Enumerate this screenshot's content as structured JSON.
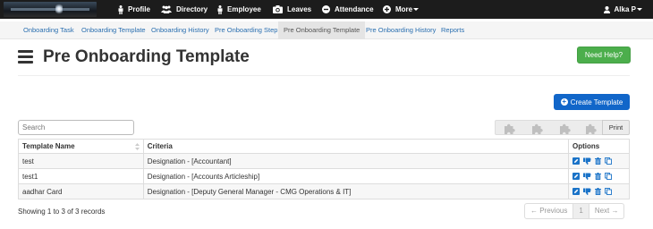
{
  "nav": {
    "items": [
      {
        "label": "Profile",
        "icon": "profile-icon"
      },
      {
        "label": "Directory",
        "icon": "directory-icon"
      },
      {
        "label": "Employee",
        "icon": "employee-icon"
      },
      {
        "label": "Leaves",
        "icon": "camera-icon"
      },
      {
        "label": "Attendance",
        "icon": "attendance-icon"
      },
      {
        "label": "More",
        "icon": "plus-circle-icon"
      }
    ],
    "user": "Alka P"
  },
  "subnav": {
    "items": [
      {
        "label": "Onboarding Task"
      },
      {
        "label": "Onboarding Template"
      },
      {
        "label": "Onboarding History"
      },
      {
        "label": "Pre Onboarding Step"
      },
      {
        "label": "Pre Onboarding Template",
        "active": true
      },
      {
        "label": "Pre Onboarding History"
      },
      {
        "label": "Reports"
      }
    ]
  },
  "page": {
    "title": "Pre Onboarding Template",
    "help_label": "Need Help?",
    "create_label": "Create Template",
    "search_placeholder": "Search",
    "print_label": "Print"
  },
  "table": {
    "columns": [
      "Template Name",
      "Criteria",
      "Options"
    ],
    "rows": [
      {
        "name": "test",
        "criteria": "Designation - [Accountant]"
      },
      {
        "name": "test1",
        "criteria": "Designation - [Accounts Articleship]"
      },
      {
        "name": "aadhar Card",
        "criteria": "Designation - [Deputy General Manager - CMG Operations & IT]"
      }
    ]
  },
  "footer": {
    "showing": "Showing 1 to 3 of 3 records",
    "prev": "← Previous",
    "page": "1",
    "next": "Next →"
  },
  "colors": {
    "topbar": "#1c1c1c",
    "link": "#2a6fb0",
    "help_button": "#4cae4c",
    "create_button": "#1166c9",
    "option_icon": "#1a73c8"
  }
}
